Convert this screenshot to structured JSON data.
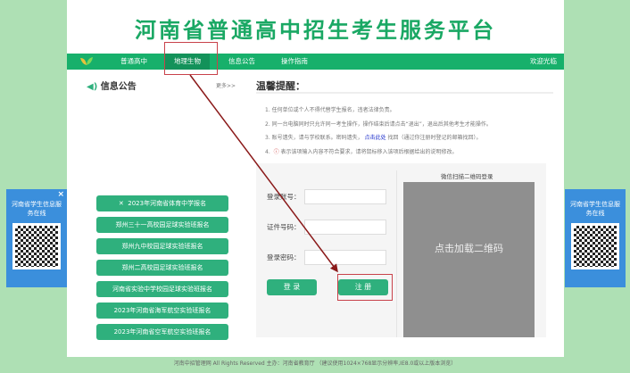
{
  "header": {
    "title": "河南省普通高中招生考生服务平台"
  },
  "nav": {
    "items": [
      "普通高中",
      "地理生物",
      "信息公告",
      "操作指南"
    ],
    "welcome": "欢迎光临"
  },
  "notice": {
    "title": "信息公告",
    "more": "更多>>"
  },
  "tips": {
    "title": "温馨提醒：",
    "lines": [
      "1. 任何单位或个人不得代替学生报名，违者法律负责。",
      "2. 同一台电脑同时只允许同一考生操作，操作结束后请点击“退出”，退出后其他考生才能操作。",
      "3. 账号遗失，请与学校联系。密码遗失，",
      "4.",
      "表示该项输入内容不符合要求，请将鼠标移入该项后根据给出的说明修改。"
    ],
    "link": "点击此处",
    "line3_tail": "找回（通过你注册时登记的邮箱找回）。"
  },
  "buttons": [
    "2023年河南省体育中学报名",
    "郑州三十一高校园足球实验班报名",
    "郑州九中校园足球实验班报名",
    "郑州二高校园足球实验班报名",
    "河南省实验中学校园足球实验班报名",
    "2023年河南省海军航空实验班报名",
    "2023年河南省空军航空实验班报名"
  ],
  "form": {
    "account_label": "登录账号：",
    "id_label": "证件号码：",
    "password_label": "登录密码：",
    "login": "登 录",
    "register": "注 册",
    "qr_title": "微信扫描二维码登录",
    "qr_load": "点击加载二维码"
  },
  "float": {
    "text": "河南省学生信息服务在线",
    "close": "×"
  },
  "footer": "河南中招管理网 All Rights Reserved 主办：河南省教育厅 （建议使用1024×768显示分辨率,IE8.0或以上版本浏览）"
}
